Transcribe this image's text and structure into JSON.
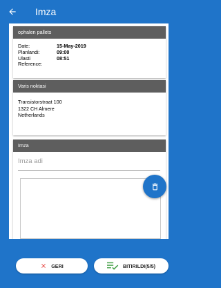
{
  "appbar": {
    "title": "Imza",
    "back_icon": "arrow-left-icon"
  },
  "card_info": {
    "header": "ophalen pallets",
    "rows": [
      {
        "label": "Date:",
        "value": "15-May-2019"
      },
      {
        "label": "Planlandi:",
        "value": "09:00"
      },
      {
        "label": "Ulasti",
        "value": "08:51"
      },
      {
        "label": "Reference:",
        "value": ""
      }
    ]
  },
  "card_address": {
    "header": "Varis noktasi",
    "lines": [
      "Transistorstraat 100",
      "1322 CH Almere",
      "Netherlands"
    ]
  },
  "card_signature": {
    "header": "Imza",
    "name_placeholder": "Imza adi",
    "delete_icon": "trash-icon"
  },
  "buttons": {
    "back_label": "GERI",
    "back_icon": "close-icon",
    "finish_label": "BITIRILDI(5/5)",
    "finish_icon": "playlist-check-icon"
  },
  "colors": {
    "primary": "#1f74c9",
    "header_gray": "#5e5e5e",
    "back_x": "#e53935",
    "finish_check": "#43a047"
  }
}
